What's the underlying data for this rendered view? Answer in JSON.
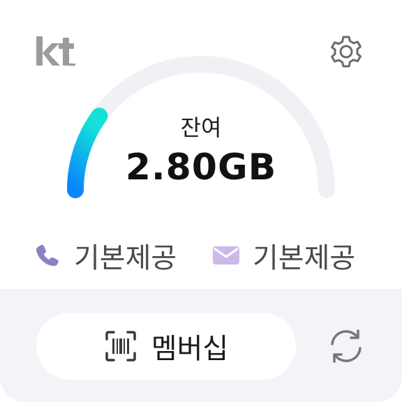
{
  "header": {
    "brand_logo": "kt-logo",
    "settings_icon": "gear-icon"
  },
  "usage": {
    "label": "잔여",
    "value": "2.80GB",
    "remaining_fraction": 0.2,
    "gauge_gradient": [
      "#0a84ff",
      "#14e0d8"
    ],
    "gauge_track_color": "#f1f1f5"
  },
  "allowances": {
    "voice": {
      "icon": "phone-icon",
      "text": "기본제공"
    },
    "sms": {
      "icon": "envelope-icon",
      "text": "기본제공"
    }
  },
  "footer": {
    "membership_label": "멤버십",
    "membership_icon": "barcode-icon",
    "refresh_icon": "refresh-icon"
  },
  "colors": {
    "icon_purple": "#8f7fc6",
    "envelope_lilac": "#cbb9ea",
    "footer_bg": "#f3f3f8"
  }
}
